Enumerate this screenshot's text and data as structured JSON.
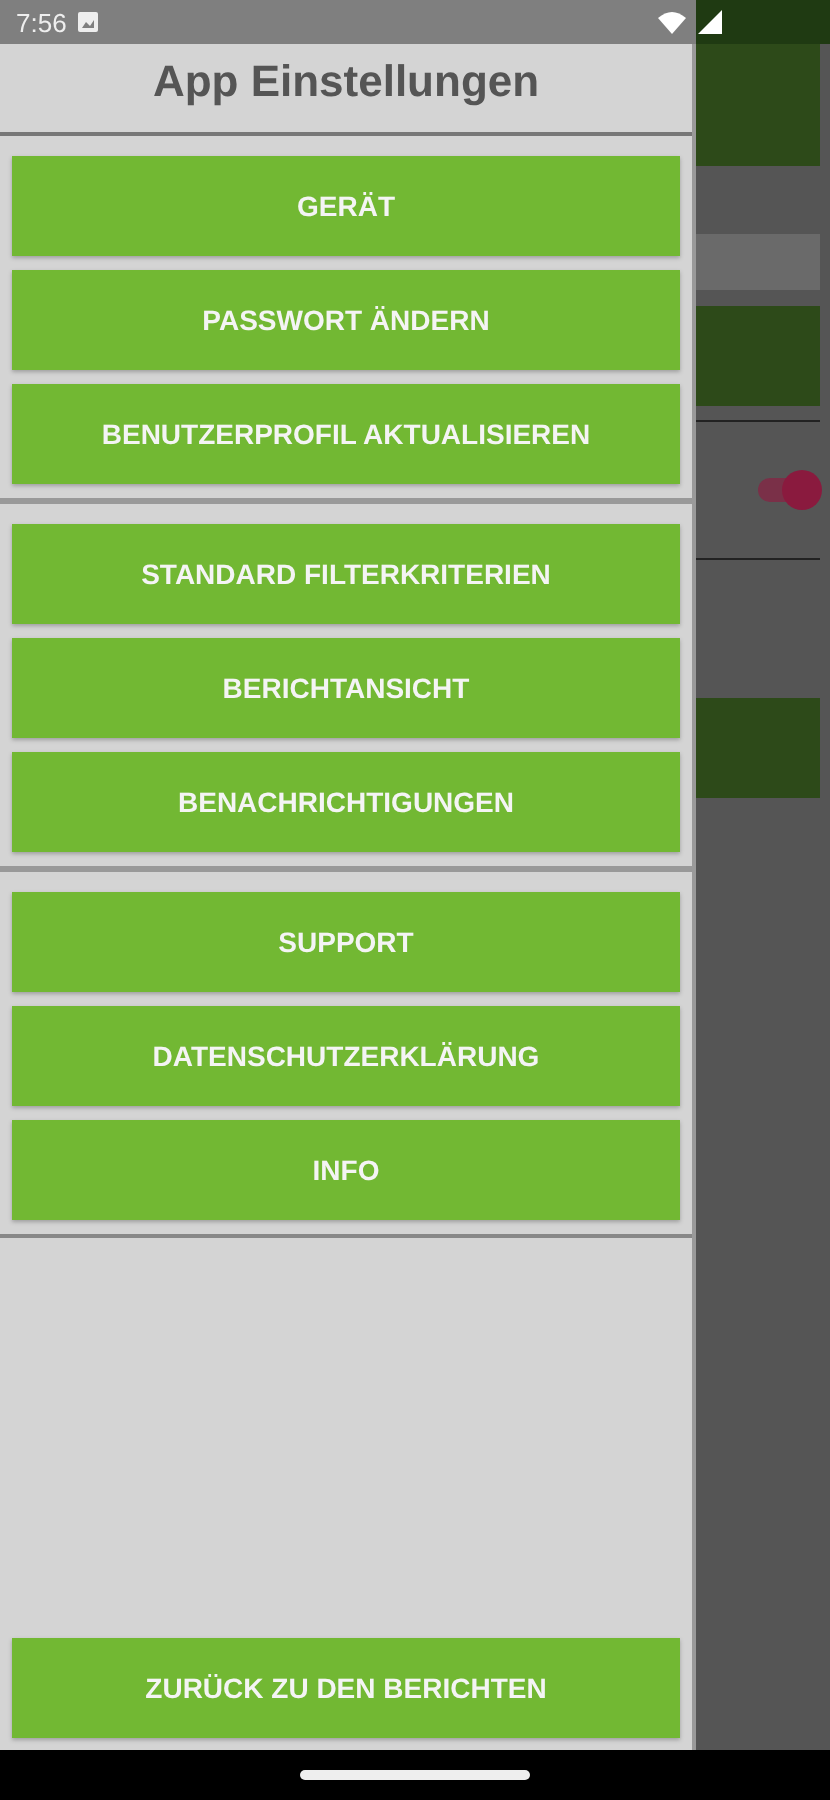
{
  "status_bar": {
    "time": "7:56"
  },
  "drawer": {
    "title": "App Einstellungen",
    "groups": [
      {
        "buttons": [
          "GERÄT",
          "PASSWORT ÄNDERN",
          "BENUTZERPROFIL AKTUALISIEREN"
        ]
      },
      {
        "buttons": [
          "STANDARD FILTERKRITERIEN",
          "BERICHTANSICHT",
          "BENACHRICHTIGUNGEN"
        ]
      },
      {
        "buttons": [
          "SUPPORT",
          "DATENSCHUTZERKLÄRUNG",
          "INFO"
        ]
      }
    ],
    "footer_button": "ZURÜCK ZU DEN BERICHTEN"
  },
  "background": {
    "toggle": {
      "on": true
    }
  }
}
